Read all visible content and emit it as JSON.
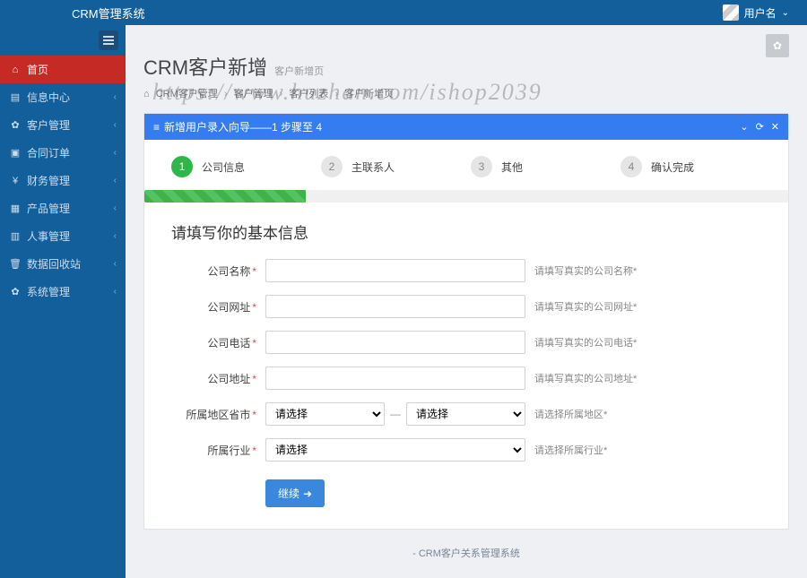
{
  "brand": "CRM管理系统",
  "user": {
    "name": "用户名"
  },
  "watermark": "https://www.huzhan.com/ishop2039",
  "sidebar": {
    "items": [
      {
        "icon": "⌂",
        "label": "首页"
      },
      {
        "icon": "▤",
        "label": "信息中心"
      },
      {
        "icon": "✿",
        "label": "客户管理"
      },
      {
        "icon": "▣",
        "label": "合同订单"
      },
      {
        "icon": "¥",
        "label": "财务管理"
      },
      {
        "icon": "▦",
        "label": "产品管理"
      },
      {
        "icon": "▥",
        "label": "人事管理"
      },
      {
        "icon": "🗑",
        "label": "数据回收站"
      },
      {
        "icon": "✿",
        "label": "系统管理"
      }
    ]
  },
  "page": {
    "title": "CRM客户新增",
    "subtitle": "客户新增页",
    "breadcrumb": [
      "CRM客户管理",
      "客户管理",
      "客户列表",
      "客户新增页"
    ]
  },
  "panel": {
    "title": "新增用户录入向导——1 步骤至 4"
  },
  "wizard": {
    "steps": [
      {
        "num": "1",
        "label": "公司信息"
      },
      {
        "num": "2",
        "label": "主联系人"
      },
      {
        "num": "3",
        "label": "其他"
      },
      {
        "num": "4",
        "label": "确认完成"
      }
    ]
  },
  "form": {
    "heading": "请填写你的基本信息",
    "fields": {
      "company_name": {
        "label": "公司名称",
        "hint": "请填写真实的公司名称"
      },
      "company_url": {
        "label": "公司网址",
        "hint": "请填写真实的公司网址"
      },
      "company_phone": {
        "label": "公司电话",
        "hint": "请填写真实的公司电话"
      },
      "company_addr": {
        "label": "公司地址",
        "hint": "请填写真实的公司地址"
      },
      "region": {
        "label": "所属地区省市",
        "placeholder": "请选择",
        "hint": "请选择所属地区"
      },
      "industry": {
        "label": "所属行业",
        "placeholder": "请选择",
        "hint": "请选择所属行业"
      }
    },
    "continue": "继续"
  },
  "footer": "- CRM客户关系管理系统"
}
